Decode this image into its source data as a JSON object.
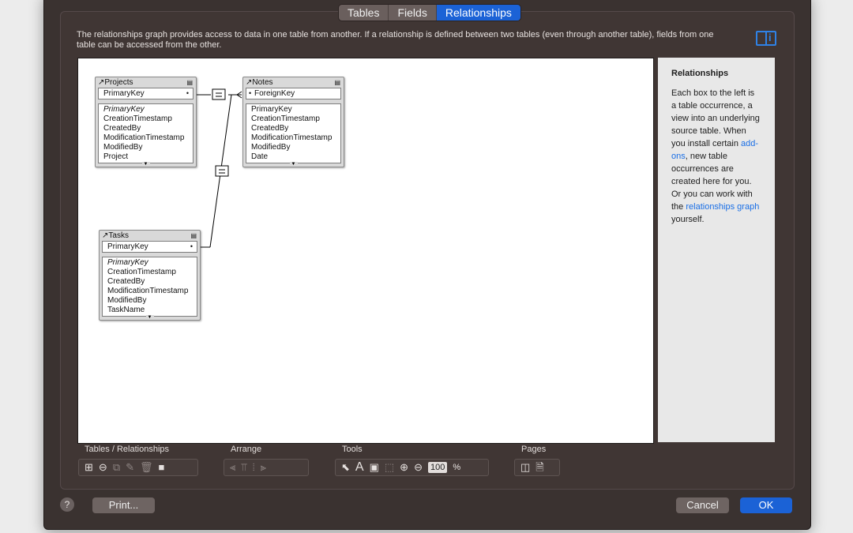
{
  "tabs": [
    "Tables",
    "Fields",
    "Relationships"
  ],
  "description": "The relationships graph provides access to data in one table from another. If a relationship is defined between two tables (even through another table), fields from one table can be accessed from the other.",
  "tables": {
    "projects": {
      "title": "Projects",
      "key": "PrimaryKey",
      "fields": [
        "PrimaryKey",
        "CreationTimestamp",
        "CreatedBy",
        "ModificationTimestamp",
        "ModifiedBy",
        "Project"
      ]
    },
    "notes": {
      "title": "Notes",
      "key": "ForeignKey",
      "fields": [
        "PrimaryKey",
        "CreationTimestamp",
        "CreatedBy",
        "ModificationTimestamp",
        "ModifiedBy",
        "Date"
      ]
    },
    "tasks": {
      "title": "Tasks",
      "key": "PrimaryKey",
      "fields": [
        "PrimaryKey",
        "CreationTimestamp",
        "CreatedBy",
        "ModificationTimestamp",
        "ModifiedBy",
        "TaskName"
      ]
    }
  },
  "sidebar": {
    "title": "Relationships",
    "text_1": "Each box to the left is a table occurrence, a view into an underlying source table. When you install certain ",
    "link_1": "add-ons",
    "text_2": ", new table occurrences are created here for you. Or you can work with the ",
    "link_2": "relationships graph",
    "text_3": " yourself."
  },
  "sections": {
    "tables": "Tables / Relationships",
    "arrange": "Arrange",
    "tools": "Tools",
    "pages": "Pages"
  },
  "zoom": "100",
  "zoom_unit": "%",
  "buttons": {
    "help": "?",
    "print": "Print...",
    "cancel": "Cancel",
    "ok": "OK"
  }
}
